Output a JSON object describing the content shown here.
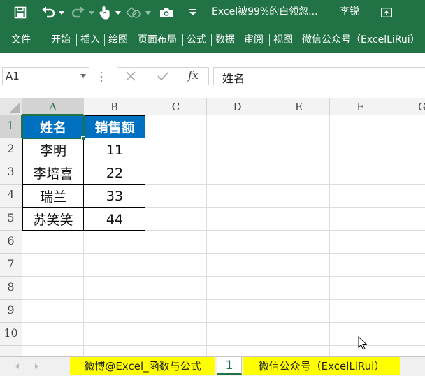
{
  "title_bar": {
    "document_title": "Excel被99%的白领忽...",
    "user": "李锐",
    "icons": [
      "save-icon",
      "undo-icon",
      "redo-icon",
      "touch-mode-icon",
      "shape-icon",
      "camera-icon",
      "ribbon-display-icon"
    ]
  },
  "ribbon": {
    "tabs": [
      "文件",
      "开始",
      "插入",
      "绘图",
      "页面布局",
      "公式",
      "数据",
      "审阅",
      "视图",
      "微信公众号（ExcelLiRui）"
    ]
  },
  "formula_bar": {
    "name_box": "A1",
    "fx": "fx",
    "content": "姓名"
  },
  "grid": {
    "columns": [
      "A",
      "B",
      "C",
      "D",
      "E",
      "F",
      "G"
    ],
    "rows": [
      "1",
      "2",
      "3",
      "4",
      "5",
      "6",
      "7",
      "8",
      "9",
      "10"
    ],
    "table": {
      "headers": [
        "姓名",
        "销售额"
      ],
      "rows": [
        [
          "李明",
          "11"
        ],
        [
          "李培喜",
          "22"
        ],
        [
          "瑞兰",
          "33"
        ],
        [
          "苏笑笑",
          "44"
        ]
      ]
    }
  },
  "sheet_tabs": [
    "微博@Excel_函数与公式",
    "1",
    "微信公众号（ExcelLiRui）"
  ],
  "colors": {
    "excel_green": "#217346",
    "header_fill": "#0070c0",
    "tab_highlight": "#ffff00"
  }
}
